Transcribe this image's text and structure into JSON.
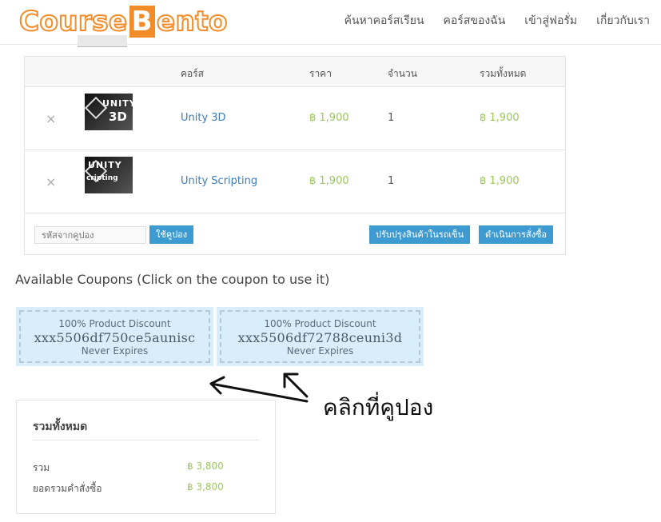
{
  "header": {
    "logo": {
      "part1": "Course",
      "part2": "B",
      "part3": "ento"
    },
    "nav": [
      "ค้นหาคอร์สเรียน",
      "คอร์สของฉัน",
      "เข้าสู่ฟอรั่ม",
      "เกี่ยวกับเรา"
    ]
  },
  "cart": {
    "columns": [
      "คอร์ส",
      "ราคา",
      "จำนวน",
      "รวมทั้งหมด"
    ],
    "items": [
      {
        "thumb_title": "UNITY",
        "thumb_subtitle": "3D",
        "name": "Unity 3D",
        "price": "฿ 1,900",
        "qty": "1",
        "total": "฿ 1,900"
      },
      {
        "thumb_title": "UNITY",
        "thumb_subtitle": "cripting",
        "name": "Unity Scripting",
        "price": "฿ 1,900",
        "qty": "1",
        "total": "฿ 1,900"
      }
    ],
    "remove_symbol": "×",
    "coupon_placeholder": "รหัสจากคูปอง",
    "apply_coupon": "ใช้คูปอง",
    "update_cart": "ปรับปรุงสินค้าในรถเข็น",
    "checkout": "ดำเนินการสั่งซื้อ"
  },
  "coupons": {
    "title": "Available Coupons (Click on the coupon to use it)",
    "list": [
      {
        "line1": "100% Product Discount",
        "code": "xxx5506df750ce5aunisc",
        "expiry": "Never Expires"
      },
      {
        "line1": "100% Product Discount",
        "code": "xxx5506df72788ceuni3d",
        "expiry": "Never Expires"
      }
    ]
  },
  "annotation": {
    "text": "คลิกที่คูปอง"
  },
  "totals": {
    "title": "รวมทั้งหมด",
    "rows": [
      {
        "label": "รวม",
        "value": "฿ 3,800"
      },
      {
        "label": "ยอดรวมคำสั่งซื้อ",
        "value": "฿ 3,800"
      }
    ]
  },
  "colors": {
    "accent": "#3e9bd1",
    "price": "#9dc85a",
    "link": "#3b7dbd",
    "logo": "#f28c28",
    "coupon_bg": "#d8eefb"
  }
}
